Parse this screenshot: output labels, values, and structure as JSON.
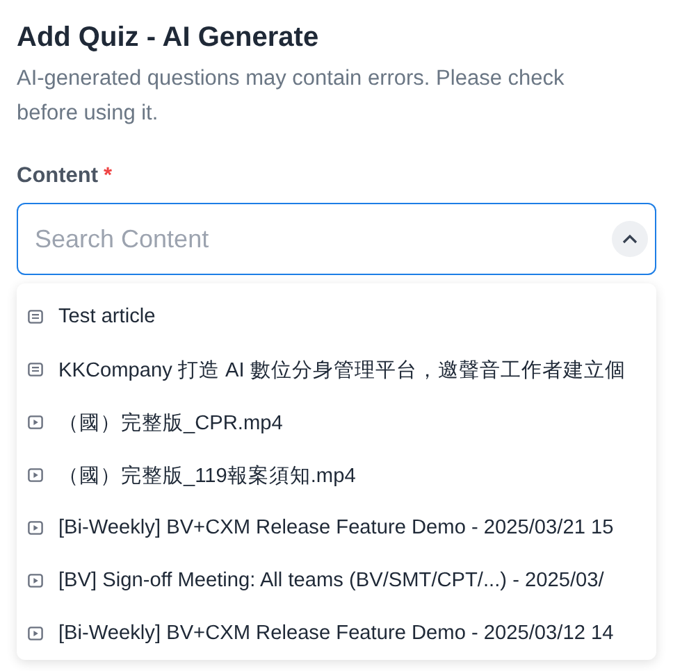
{
  "dialog": {
    "title": "Add Quiz - AI Generate",
    "notice": "AI-generated questions may contain errors. Please check before using it."
  },
  "content_field": {
    "label": "Content",
    "required_mark": "*",
    "placeholder": "Search Content",
    "focused": true,
    "expanded": true
  },
  "options": [
    {
      "kind": "article",
      "label": "Test article"
    },
    {
      "kind": "article",
      "label": "KKCompany 打造 AI 數位分身管理平台，邀聲音工作者建立個"
    },
    {
      "kind": "video",
      "label": "（國）完整版_CPR.mp4"
    },
    {
      "kind": "video",
      "label": "（國）完整版_119報案須知.mp4"
    },
    {
      "kind": "video",
      "label": "[Bi-Weekly] BV+CXM Release Feature Demo - 2025/03/21 15"
    },
    {
      "kind": "video",
      "label": "[BV] Sign-off Meeting: All teams (BV/SMT/CPT/...) - 2025/03/"
    },
    {
      "kind": "video",
      "label": "[Bi-Weekly] BV+CXM Release Feature Demo - 2025/03/12 14"
    }
  ]
}
